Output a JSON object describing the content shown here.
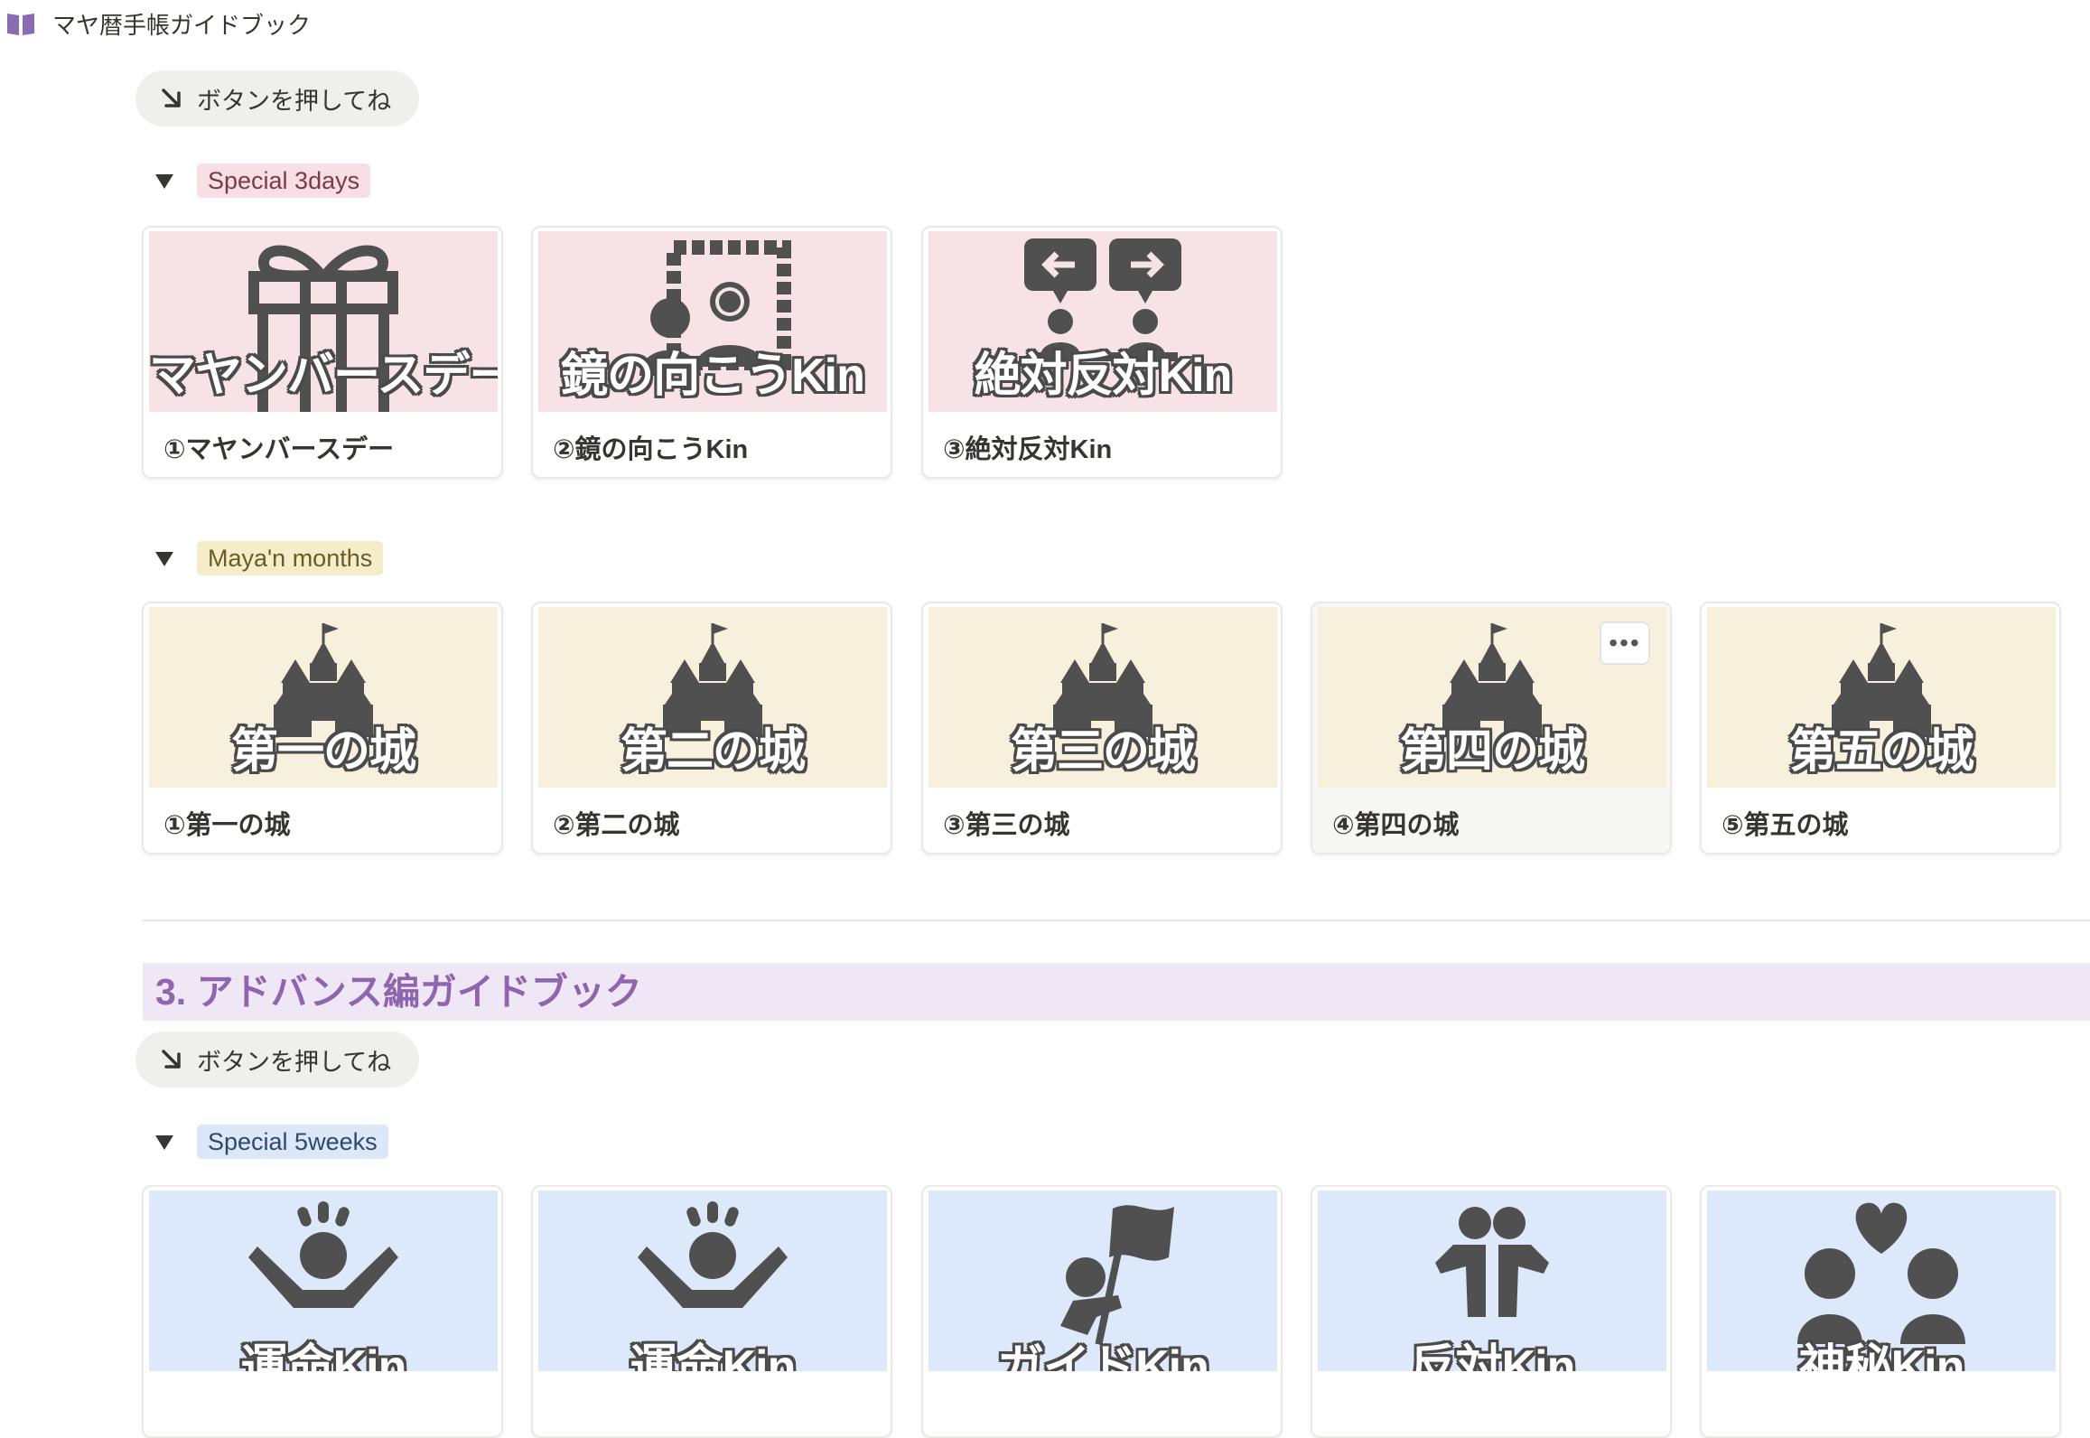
{
  "breadcrumb": {
    "icon": "open-book-icon",
    "title": "マヤ暦手帳ガイドブック"
  },
  "buttons": [
    {
      "label": "ボタンを押してね",
      "icon": "arrow-down-right-icon"
    },
    {
      "label": "ボタンを押してね",
      "icon": "arrow-down-right-icon"
    }
  ],
  "groups": [
    {
      "tag": "Special 3days",
      "color": "#f8dfe3",
      "cards": [
        {
          "cover_text": "マヤンバースデー",
          "title": "①マヤンバースデー",
          "icon": "gift-icon"
        },
        {
          "cover_text": "鏡の向こうKin",
          "title": "②鏡の向こうKin",
          "icon": "mirror-portrait-icon"
        },
        {
          "cover_text": "絶対反対Kin",
          "title": "③絶対反対Kin",
          "icon": "opposite-arrows-people-icon"
        }
      ]
    },
    {
      "tag": "Maya'n months",
      "color": "#f5ecc9",
      "cards": [
        {
          "cover_text": "第一の城",
          "title": "①第一の城",
          "icon": "castle-icon"
        },
        {
          "cover_text": "第二の城",
          "title": "②第二の城",
          "icon": "castle-icon"
        },
        {
          "cover_text": "第三の城",
          "title": "③第三の城",
          "icon": "castle-icon"
        },
        {
          "cover_text": "第四の城",
          "title": "④第四の城",
          "icon": "castle-icon"
        },
        {
          "cover_text": "第五の城",
          "title": "⑤第五の城",
          "icon": "castle-icon"
        }
      ]
    },
    {
      "tag": "Special 5weeks",
      "color": "#dce8f8",
      "cards": [
        {
          "cover_text": "運命Kin",
          "icon": "cheering-person-icon"
        },
        {
          "cover_text": "運命Kin",
          "icon": "cheering-person-icon"
        },
        {
          "cover_text": "ガイドKin",
          "icon": "flag-person-icon"
        },
        {
          "cover_text": "反対Kin",
          "icon": "two-people-icon"
        },
        {
          "cover_text": "神秘Kin",
          "icon": "people-heart-icon"
        }
      ]
    }
  ],
  "heading": "3. アドバンス編ガイドブック",
  "more_button": "•••"
}
